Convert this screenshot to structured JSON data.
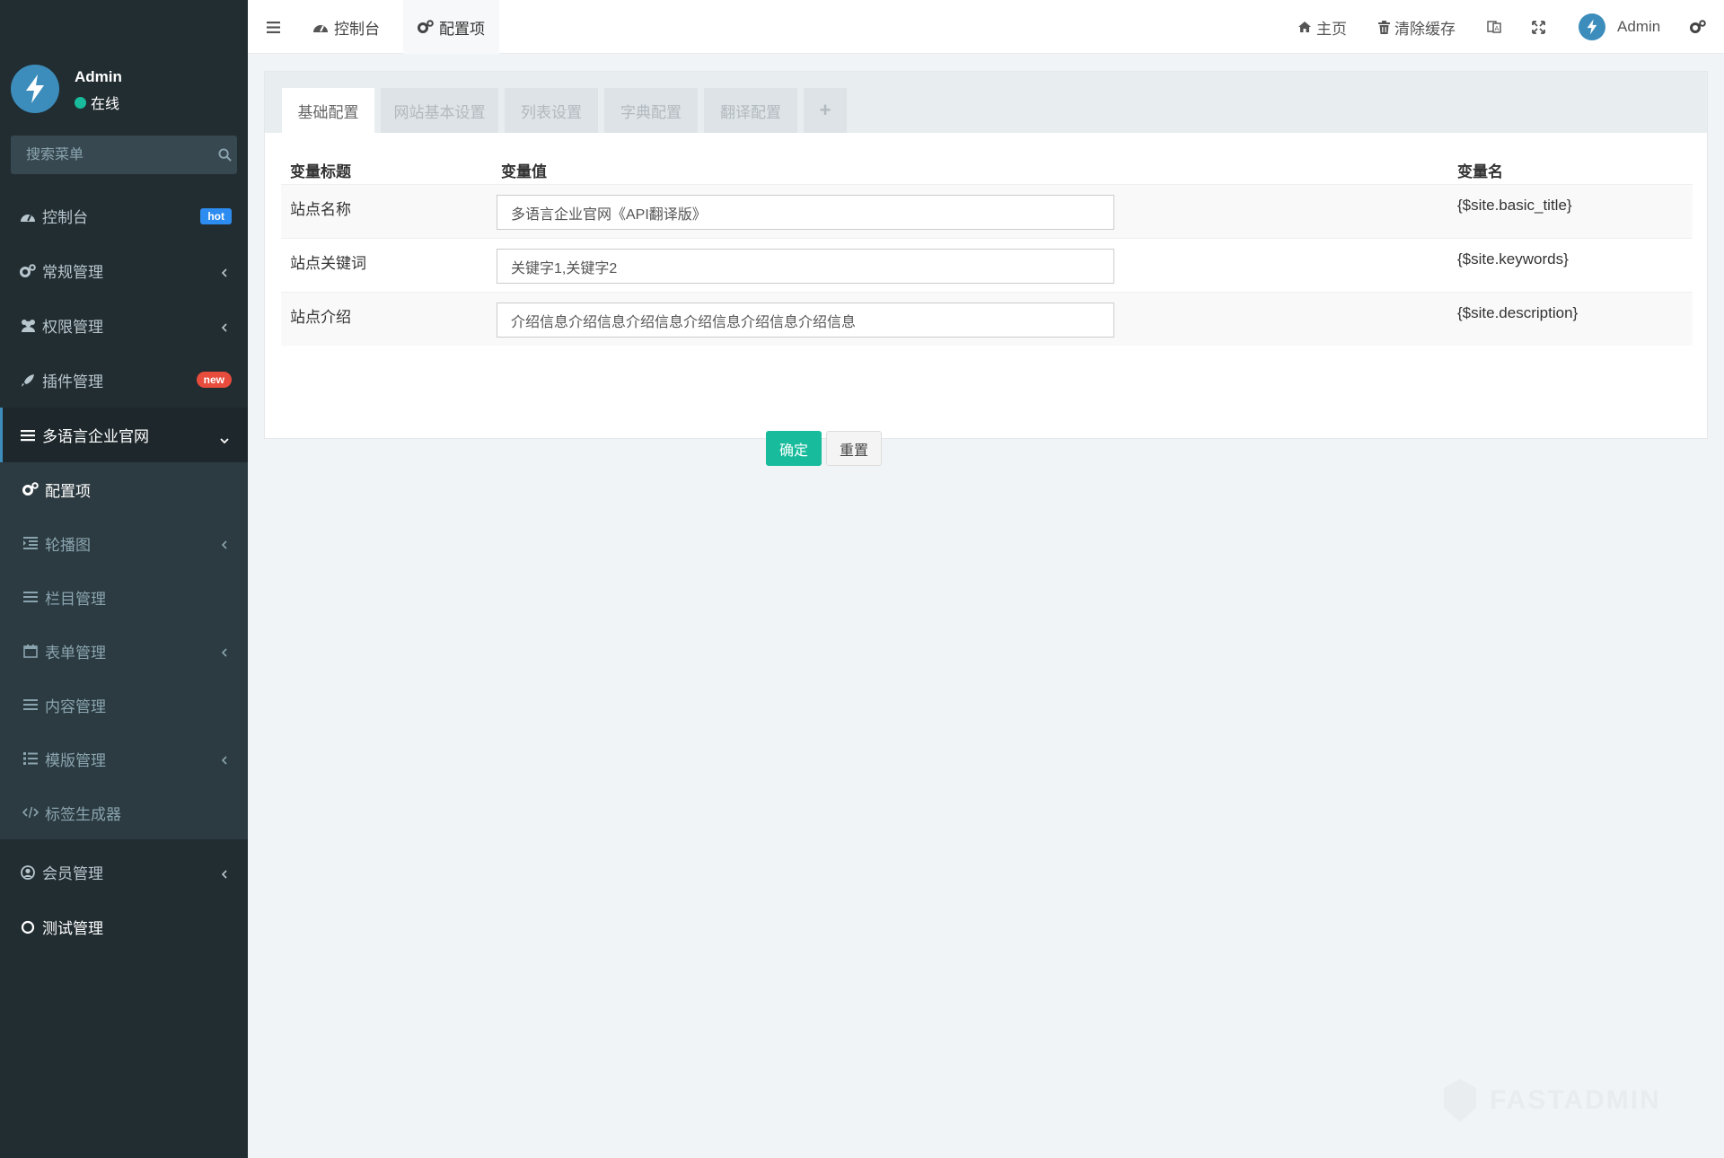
{
  "sidebar": {
    "user": {
      "name": "Admin",
      "status": "在线"
    },
    "search": {
      "placeholder": "搜索菜单"
    },
    "items": [
      {
        "label": "控制台",
        "icon": "dashboard-icon",
        "badge": "hot"
      },
      {
        "label": "常规管理",
        "icon": "cogs-icon"
      },
      {
        "label": "权限管理",
        "icon": "group-icon"
      },
      {
        "label": "插件管理",
        "icon": "rocket-icon",
        "badge": "new"
      },
      {
        "label": "多语言企业官网",
        "icon": "list-icon"
      }
    ],
    "submenu": [
      {
        "label": "配置项",
        "icon": "cogs-icon"
      },
      {
        "label": "轮播图",
        "icon": "indent-icon"
      },
      {
        "label": "栏目管理",
        "icon": "list-icon"
      },
      {
        "label": "表单管理",
        "icon": "calendar-icon"
      },
      {
        "label": "内容管理",
        "icon": "list-icon"
      },
      {
        "label": "模版管理",
        "icon": "list-ol-icon"
      },
      {
        "label": "标签生成器",
        "icon": "code-icon"
      }
    ],
    "bottom_items": [
      {
        "label": "会员管理",
        "icon": "user-circle-icon"
      },
      {
        "label": "测试管理",
        "icon": "circle-icon"
      }
    ]
  },
  "navbar": {
    "tabs": [
      "控制台",
      "配置项"
    ],
    "home_label": "主页",
    "clear_cache_label": "清除缓存",
    "admin_name": "Admin"
  },
  "config": {
    "tabs": [
      "基础配置",
      "网站基本设置",
      "列表设置",
      "字典配置",
      "翻译配置",
      "+"
    ],
    "headers": {
      "title": "变量标题",
      "value": "变量值",
      "name": "变量名"
    },
    "rows": [
      {
        "title": "站点名称",
        "value": "多语言企业官网《API翻译版》",
        "name": "{$site.basic_title}"
      },
      {
        "title": "站点关键词",
        "value": "关键字1,关键字2",
        "name": "{$site.keywords}"
      },
      {
        "title": "站点介绍",
        "value": "介绍信息介绍信息介绍信息介绍信息介绍信息介绍信息",
        "name": "{$site.description}"
      }
    ],
    "ok_label": "确定",
    "reset_label": "重置"
  },
  "watermark": "FASTADMIN",
  "colors": {
    "sidebar_bg": "#222d32",
    "accent": "#3c8dbc",
    "success": "#18bc9c",
    "danger": "#e74c3c"
  }
}
